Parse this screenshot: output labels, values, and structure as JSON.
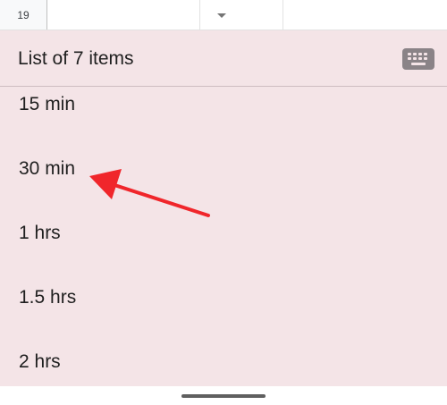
{
  "spreadsheet": {
    "row_number": "19"
  },
  "list_sheet": {
    "title": "List of 7 items",
    "keyboard_icon": "keyboard-icon",
    "items": [
      "15 min",
      "30 min",
      "1 hrs",
      "1.5 hrs",
      "2 hrs"
    ]
  },
  "colors": {
    "panel_background": "#f4e4e7",
    "annotation_arrow": "#f0262b"
  }
}
